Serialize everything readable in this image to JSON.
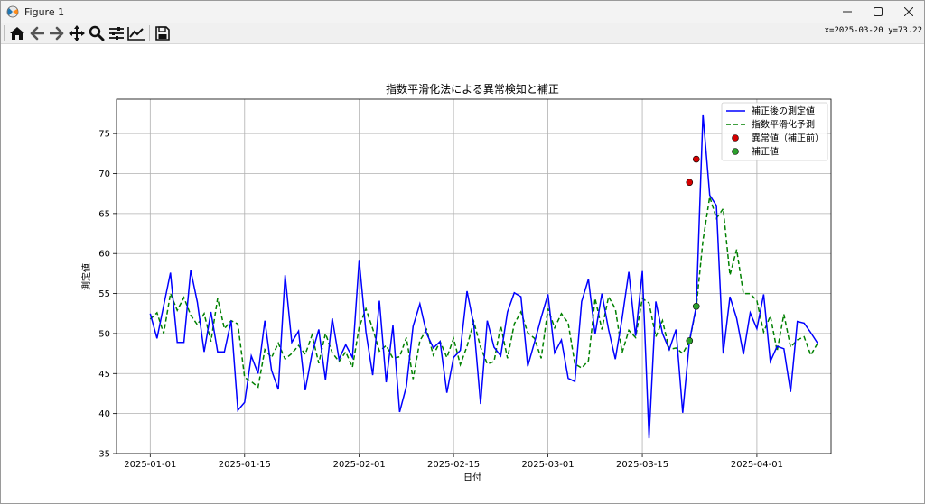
{
  "window": {
    "title": "Figure 1",
    "icon": "matplotlib-icon",
    "controls": [
      "minimize-icon",
      "maximize-icon",
      "close-icon"
    ]
  },
  "toolbar": {
    "buttons": [
      "home-icon",
      "back-arrow-icon",
      "forward-arrow-icon",
      "pan-icon",
      "zoom-icon",
      "configure-subplots-icon",
      "edit-axis-icon",
      "save-icon"
    ],
    "coord_readout": "x=2025-03-20 y=73.22"
  },
  "chart_data": {
    "type": "line",
    "title": "指数平滑化法による異常検知と補正",
    "xlabel": "日付",
    "ylabel": "測定値",
    "x_start": "2025-01-01",
    "x_end": "2025-04-08",
    "x_lim": [
      "2024-12-27",
      "2025-04-12"
    ],
    "ylim": [
      35,
      79.3
    ],
    "x_ticks": [
      "2025-01-01",
      "2025-01-15",
      "2025-02-01",
      "2025-02-15",
      "2025-03-01",
      "2025-03-15",
      "2025-04-01"
    ],
    "y_ticks": [
      35,
      40,
      45,
      50,
      55,
      60,
      65,
      70,
      75
    ],
    "grid": true,
    "legend_position": "top-right",
    "colors": {
      "corrected": "#0000ff",
      "predicted": "#008000",
      "anomaly": "#d40000",
      "correction": "#2ca02c"
    },
    "series": [
      {
        "name": "補正後の測定値",
        "style": "solid",
        "values": [
          52.5,
          49.4,
          53.5,
          57.6,
          48.9,
          48.9,
          57.9,
          53.9,
          47.7,
          52.7,
          47.7,
          47.7,
          51.6,
          40.4,
          41.4,
          47.2,
          45.0,
          51.6,
          45.4,
          43.0,
          57.3,
          48.9,
          50.3,
          42.9,
          47.5,
          50.5,
          44.2,
          51.9,
          46.8,
          48.6,
          47.0,
          59.2,
          50.2,
          44.8,
          54.1,
          43.9,
          51.0,
          40.2,
          43.4,
          50.9,
          53.7,
          50.0,
          48.2,
          49.0,
          42.6,
          47.0,
          47.9,
          55.3,
          51.1,
          41.2,
          51.6,
          48.3,
          47.2,
          52.7,
          55.1,
          54.6,
          45.9,
          48.9,
          52.0,
          54.9,
          47.6,
          49.2,
          44.4,
          44.0,
          54.0,
          56.8,
          49.9,
          55.0,
          50.5,
          46.8,
          51.9,
          57.7,
          49.7,
          57.8,
          36.9,
          54.0,
          50.0,
          48.0,
          50.5,
          40.1,
          49.1,
          53.4,
          77.4,
          67.3,
          66.0,
          47.5,
          54.6,
          51.9,
          47.4,
          52.6,
          50.6,
          54.9,
          46.5,
          48.4,
          48.1,
          42.7,
          51.5,
          51.3,
          50.1,
          48.8
        ]
      },
      {
        "name": "指数平滑化予測",
        "style": "dashed",
        "values": [
          51.8,
          52.6,
          50.0,
          55.0,
          52.9,
          54.5,
          52.3,
          51.1,
          52.5,
          49.0,
          54.4,
          50.6,
          51.6,
          51.2,
          44.5,
          44.0,
          43.3,
          48.0,
          47.0,
          48.8,
          46.8,
          47.5,
          48.5,
          47.4,
          49.8,
          46.3,
          50.0,
          47.6,
          46.5,
          47.7,
          45.8,
          50.8,
          53.1,
          50.6,
          47.8,
          48.5,
          46.9,
          47.1,
          49.5,
          44.3,
          49.1,
          50.5,
          47.3,
          49.0,
          47.0,
          49.4,
          46.1,
          48.4,
          51.5,
          48.3,
          46.2,
          46.5,
          51.0,
          46.9,
          51.2,
          52.7,
          50.1,
          49.4,
          46.9,
          53.1,
          50.7,
          52.5,
          51.3,
          46.2,
          45.7,
          46.6,
          54.4,
          50.5,
          54.6,
          53.1,
          47.6,
          50.4,
          49.5,
          54.4,
          53.8,
          49.6,
          51.6,
          48.0,
          48.2,
          47.5,
          49.0,
          53.3,
          61.6,
          67.1,
          64.4,
          65.6,
          57.3,
          60.5,
          55.0,
          55.0,
          54.1,
          50.2,
          52.2,
          47.8,
          52.4,
          48.3,
          49.2,
          49.6,
          47.3,
          48.8
        ]
      },
      {
        "name": "異常値（補正前）",
        "style": "marker",
        "points": [
          {
            "x": "2025-03-22",
            "y": 68.9
          },
          {
            "x": "2025-03-23",
            "y": 71.8
          }
        ]
      },
      {
        "name": "補正値",
        "style": "marker",
        "points": [
          {
            "x": "2025-03-22",
            "y": 49.1
          },
          {
            "x": "2025-03-23",
            "y": 53.4
          }
        ]
      }
    ]
  }
}
